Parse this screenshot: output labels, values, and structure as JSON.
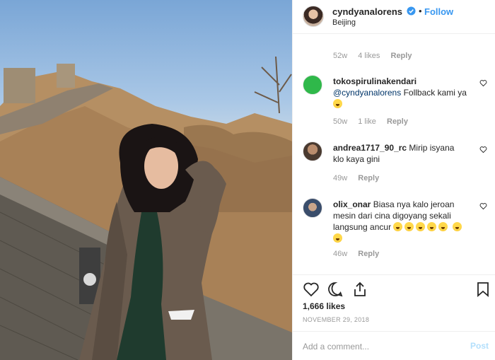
{
  "post": {
    "username": "cyndyanalorens",
    "follow_label": "Follow",
    "dot": "•",
    "location": "Beijing",
    "photo_alt": ""
  },
  "comments": [
    {
      "meta": {
        "time": "52w",
        "likes": "4 likes",
        "reply": "Reply"
      }
    },
    {
      "username": "tokospirulinakendari",
      "mention": "@cyndyanalorens",
      "text": " Follback kami ya",
      "meta": {
        "time": "50w",
        "likes": "1 like",
        "reply": "Reply"
      }
    },
    {
      "username": "andrea1717_90_rc",
      "text": " Mirip isyana klo kaya gini",
      "meta": {
        "time": "49w",
        "reply": "Reply"
      }
    },
    {
      "username": "olix_onar",
      "text": " Biasa nya kalo jeroan mesin dari cina digoyang sekali langsung ancur",
      "meta": {
        "time": "46w",
        "reply": "Reply"
      }
    }
  ],
  "actions": {
    "likes": "1,666 likes",
    "date": "NOVEMBER 29, 2018"
  },
  "add_comment": {
    "placeholder": "Add a comment...",
    "post_label": "Post"
  },
  "colors": {
    "accent": "#3897f0",
    "muted": "#999999",
    "post_disabled": "#b2dffc"
  },
  "icons": [
    "verified-badge-icon",
    "heart-icon",
    "comment-icon",
    "share-icon",
    "bookmark-icon"
  ]
}
